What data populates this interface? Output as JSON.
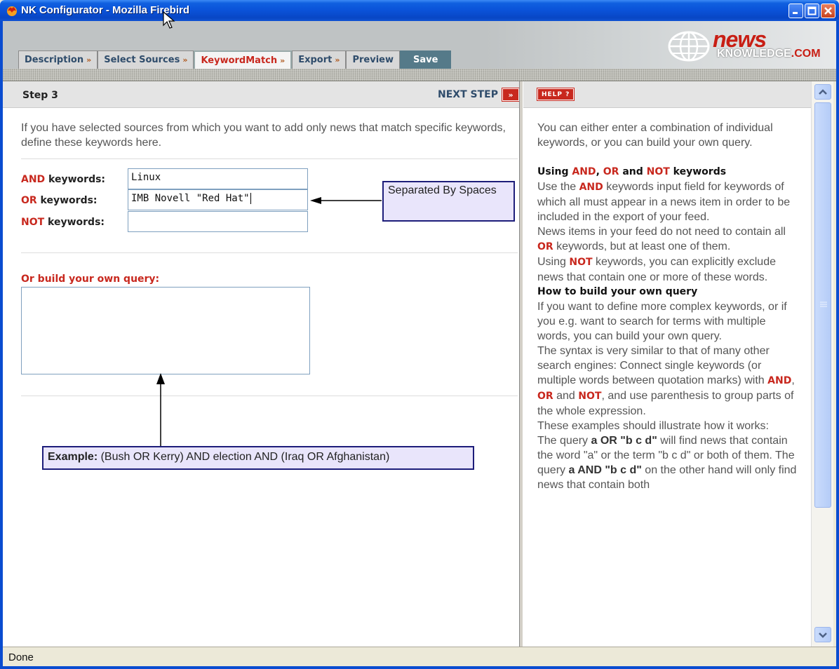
{
  "window": {
    "title": "NK Configurator - Mozilla Firebird"
  },
  "logo": {
    "news": "news",
    "knowledge": "KNOWLEDGE",
    "dotcom": ".COM"
  },
  "tabs": [
    {
      "label": "Description",
      "arrow": "»"
    },
    {
      "label": "Select Sources",
      "arrow": "»"
    },
    {
      "label": "KeywordMatch",
      "arrow": "»"
    },
    {
      "label": "Export",
      "arrow": "»"
    },
    {
      "label": "Preview",
      "arrow": ""
    },
    {
      "label": "Save",
      "arrow": ""
    }
  ],
  "step": {
    "title": "Step 3",
    "next_label": "NEXT STEP",
    "next_icon": "»"
  },
  "intro": "If you have selected sources from which you want to add only news that match specific keywords, define these keywords here.",
  "keywords": {
    "and_op": "AND",
    "and_suffix": " keywords:",
    "and_value": "Linux",
    "or_op": "OR",
    "or_suffix": " keywords:",
    "or_value": "IMB Novell \"Red Hat\"",
    "not_op": "NOT",
    "not_suffix": " keywords:",
    "not_value": ""
  },
  "callout_spaces": "Separated By Spaces",
  "query": {
    "label": "Or build your own query:",
    "value": ""
  },
  "example": {
    "label": "Example:",
    "text": " (Bush OR Kerry) AND election AND (Iraq OR Afghanistan)"
  },
  "help": {
    "badge": "HELP ?",
    "intro": "You can either enter a combination of individual keywords, or you can build your own query.",
    "heading1_a": "Using ",
    "and": "AND",
    "comma": ", ",
    "or": "OR",
    "and_word": " and ",
    "not": "NOT",
    "heading1_b": " keywords",
    "p1_a": "Use the ",
    "p1_b": " keywords input field for keywords of which all must appear in a news item in order to be included in the export of your feed.",
    "p2_a": "News items in your feed do not need to contain all ",
    "p2_b": " keywords, but at least one of them.",
    "p3_a": "Using ",
    "p3_b": " keywords, you can explicitly exclude news that contain one or more of these words.",
    "heading2": "How to build your own query",
    "p4": "If you want to define more complex keywords, or if you e.g. want to search for terms with multiple words, you can build your own query.",
    "p5_a": "The syntax is very similar to that of many other search engines: Connect single keywords (or multiple words between quotation marks) with ",
    "p5_b": ", ",
    "p5_c": " and ",
    "p5_d": ", and use parenthesis to group parts of the whole expression.",
    "p6": "These examples should illustrate how it works:",
    "p7_a": "The query ",
    "p7_q1": "a OR \"b c d\"",
    "p7_b": " will find news that contain the word \"a\" or the term \"b c d\" or both of them. The query ",
    "p7_q2": "a AND \"b c d\"",
    "p7_c": " on the other hand will only find news that contain both"
  },
  "status": {
    "text": "Done"
  }
}
